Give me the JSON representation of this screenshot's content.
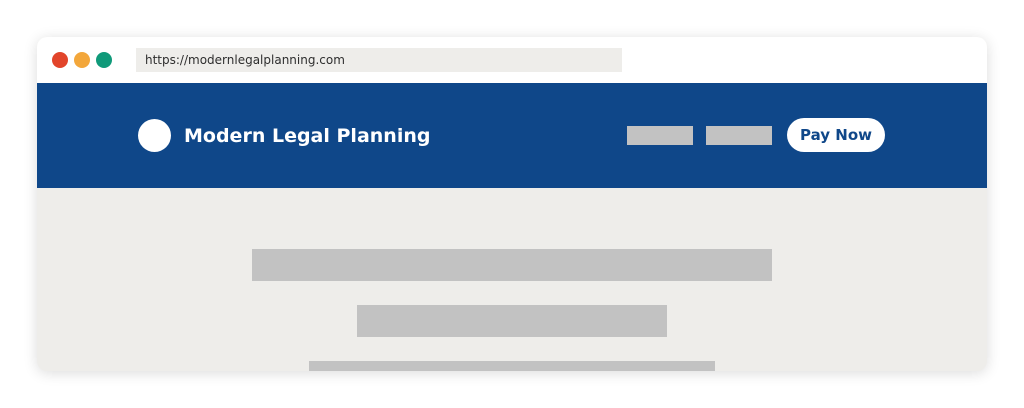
{
  "browser": {
    "url": "https://modernlegalplanning.com",
    "controls": {
      "close_color": "#e2452b",
      "minimize_color": "#f3a73b",
      "maximize_color": "#109a7a"
    }
  },
  "header": {
    "site_title": "Modern Legal Planning",
    "pay_button_label": "Pay Now",
    "background_color": "#0f4789",
    "accent_color": "#0f4789"
  },
  "content": {
    "placeholder_color": "#c2c2c2",
    "background_color": "#eeedea"
  }
}
